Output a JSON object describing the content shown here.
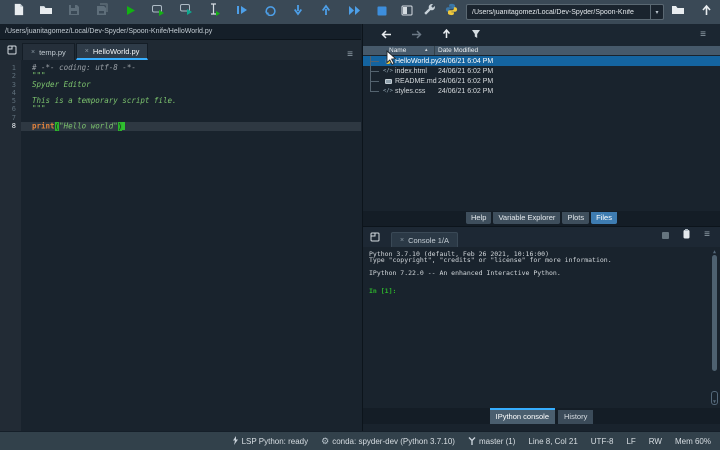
{
  "window": {
    "working_dir": "/Users/juanitagomez/Local/Dev-Spyder/Spoon-Knife"
  },
  "toolbar": {
    "icons": [
      "new-file-icon",
      "open-file-icon",
      "save-icon",
      "save-all-icon",
      "run-file-icon",
      "run-cell-icon",
      "run-cell-advance-icon",
      "run-selection-icon",
      "debug-file-icon",
      "rerun-icon",
      "step-into-icon",
      "step-return-icon",
      "continue-icon",
      "stop-icon",
      "maximize-pane-icon",
      "preferences-wrench-icon",
      "python-logo-icon",
      "open-directory-icon",
      "parent-directory-icon"
    ]
  },
  "editor": {
    "breadcrumb": "/Users/juanitagomez/Local/Dev-Spyder/Spoon-Knife/HelloWorld.py",
    "tabs": [
      {
        "label": "temp.py",
        "active": false
      },
      {
        "label": "HelloWorld.py",
        "active": true
      }
    ],
    "close_glyph": "×",
    "lines": [
      {
        "n": 1,
        "segs": [
          {
            "t": "# -*- coding: utf-8 -*-",
            "c": "comment"
          }
        ]
      },
      {
        "n": 2,
        "segs": [
          {
            "t": "\"\"\"",
            "c": "str"
          }
        ]
      },
      {
        "n": 3,
        "segs": [
          {
            "t": "Spyder Editor",
            "c": "str"
          }
        ]
      },
      {
        "n": 4,
        "segs": []
      },
      {
        "n": 5,
        "segs": [
          {
            "t": "This is a temporary script file.",
            "c": "str"
          }
        ]
      },
      {
        "n": 6,
        "segs": [
          {
            "t": "\"\"\"",
            "c": "str"
          }
        ]
      },
      {
        "n": 7,
        "segs": []
      },
      {
        "n": 8,
        "current": true,
        "segs": [
          {
            "t": "print",
            "c": "builtin"
          },
          {
            "t": "(",
            "c": "paren"
          },
          {
            "t": "\"Hello world\"",
            "c": "str"
          },
          {
            "t": ")",
            "c": "paren"
          },
          {
            "t": "",
            "c": "cursor"
          }
        ]
      }
    ]
  },
  "explorer": {
    "columns": {
      "name": "Name",
      "date": "Date Modified"
    },
    "sort_glyph": "▴",
    "rows": [
      {
        "name": "HelloWorld.py",
        "date": "24/06/21 6:04 PM",
        "icon": "python-file-icon",
        "selected": true
      },
      {
        "name": "index.html",
        "date": "24/06/21 6:02 PM",
        "icon": "code-file-icon",
        "selected": false
      },
      {
        "name": "README.md",
        "date": "24/06/21 6:02 PM",
        "icon": "markdown-file-icon",
        "selected": false
      },
      {
        "name": "styles.css",
        "date": "24/06/21 6:02 PM",
        "icon": "code-file-icon",
        "selected": false
      }
    ]
  },
  "panel_tabs": [
    {
      "label": "Help",
      "active": false
    },
    {
      "label": "Variable Explorer",
      "active": false
    },
    {
      "label": "Plots",
      "active": false
    },
    {
      "label": "Files",
      "active": true
    }
  ],
  "console": {
    "tab_label": "Console 1/A",
    "lines": [
      "Python 3.7.10 (default, Feb 26 2021, 10:16:00)",
      "Type \"copyright\", \"credits\" or \"license\" for more information.",
      "",
      "IPython 7.22.0 -- An enhanced Interactive Python.",
      ""
    ],
    "prompt": "In [1]:",
    "bottom_tabs": [
      {
        "label": "IPython console",
        "active": true
      },
      {
        "label": "History",
        "active": false
      }
    ]
  },
  "statusbar": {
    "lsp": "LSP Python: ready",
    "conda": "conda: spyder-dev (Python 3.7.10)",
    "git_branch": "master (1)",
    "cursor_position": "Line 8, Col 21",
    "encoding": "UTF-8",
    "eol": "LF",
    "permissions": "RW",
    "memory": "Mem 60%"
  },
  "colors": {
    "accent": "#37AEFE",
    "selection": "#1464A0",
    "run_green": "#12B212",
    "debug_blue": "#4D9FE8",
    "string_green": "#7DC46E",
    "builtin_orange": "#E0823D"
  }
}
